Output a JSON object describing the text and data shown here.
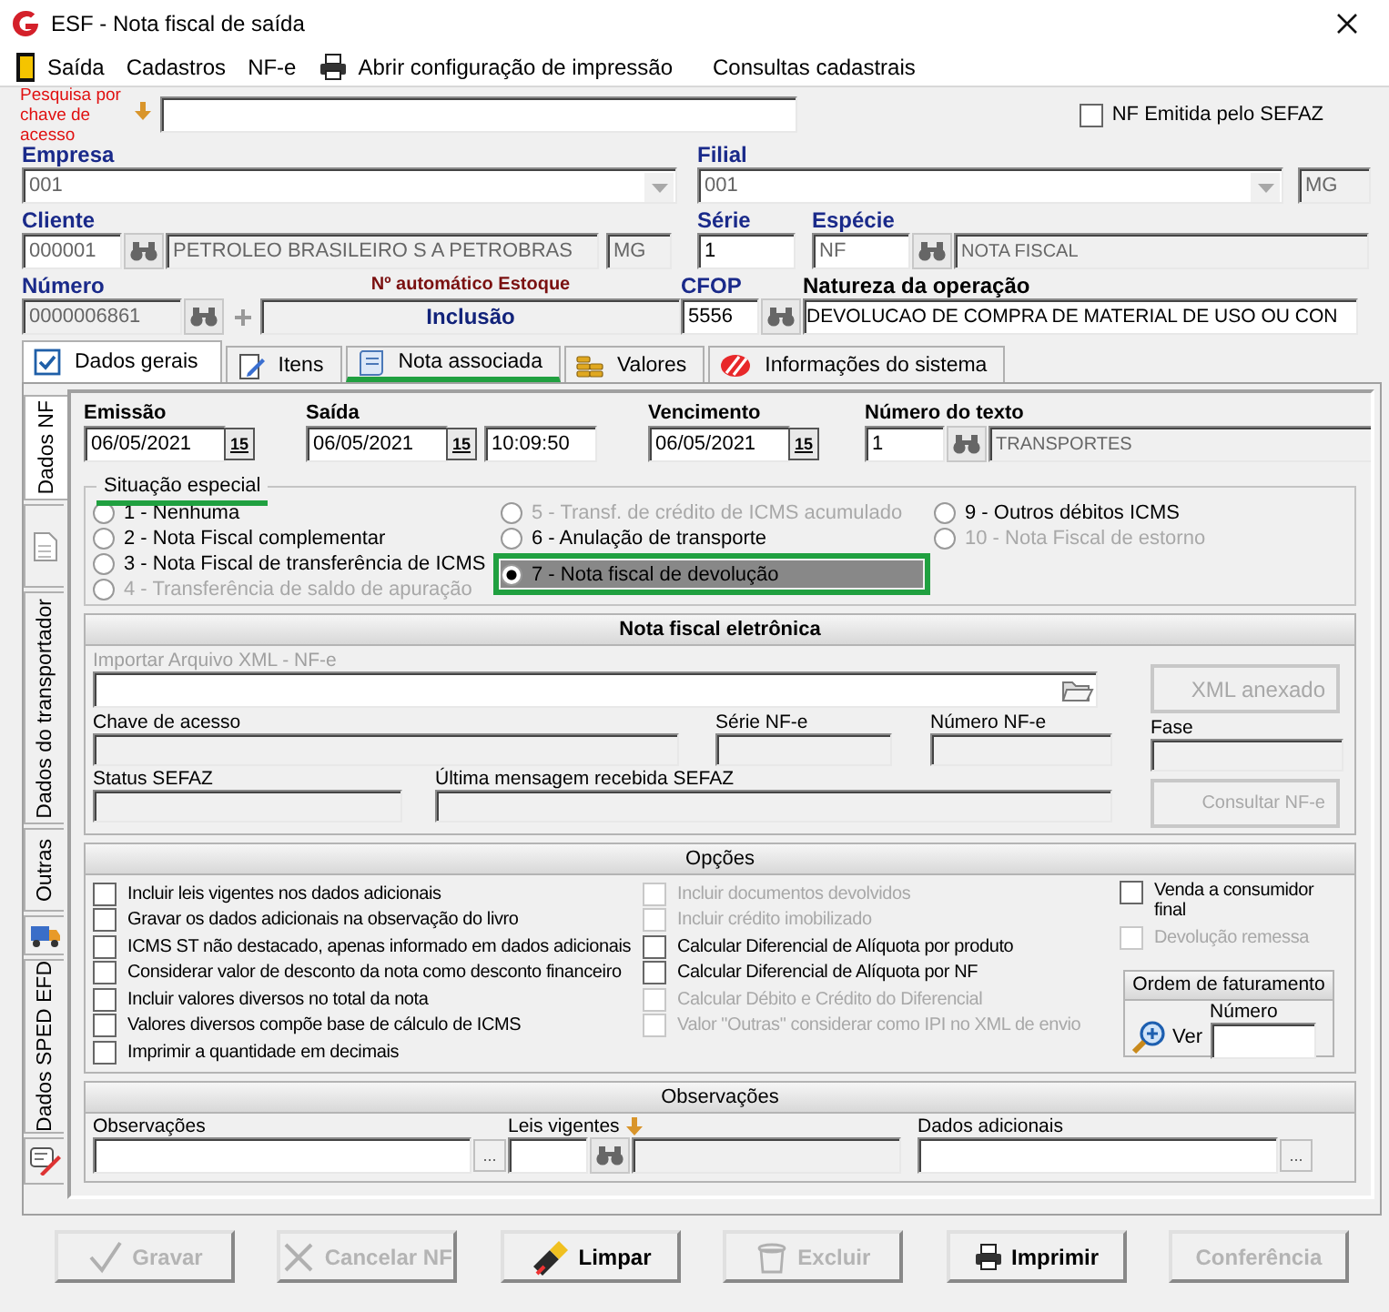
{
  "window": {
    "title": "ESF - Nota fiscal de saída"
  },
  "menu": [
    {
      "label": "Saída"
    },
    {
      "label": "Cadastros"
    },
    {
      "label": "NF-e"
    },
    {
      "label": "Abrir configuração de impressão"
    },
    {
      "label": "Consultas cadastrais"
    }
  ],
  "search": {
    "label": "Pesquisa por chave de acesso"
  },
  "nf_sefaz": {
    "label": "NF Emitida pelo SEFAZ",
    "checked": false
  },
  "empresa": {
    "label": "Empresa",
    "value": "001"
  },
  "filial": {
    "label": "Filial",
    "value": "001",
    "uf": "MG"
  },
  "cliente": {
    "label": "Cliente",
    "code": "000001",
    "name": "PETROLEO BRASILEIRO S A PETROBRAS",
    "uf": "MG"
  },
  "serie": {
    "label": "Série",
    "value": "1"
  },
  "especie": {
    "label": "Espécie",
    "code": "NF",
    "name": "NOTA FISCAL"
  },
  "numero": {
    "label": "Número",
    "value": "0000006861"
  },
  "estoque": {
    "label": "Nº automático Estoque",
    "status": "Inclusão"
  },
  "cfop": {
    "label": "CFOP",
    "value": "5556"
  },
  "natureza": {
    "label": "Natureza da operação",
    "value": "DEVOLUCAO DE COMPRA DE MATERIAL DE USO OU CON"
  },
  "tabs": [
    {
      "label": "Dados gerais",
      "selected": true,
      "highlighted": false
    },
    {
      "label": "Itens",
      "selected": false,
      "highlighted": false
    },
    {
      "label": "Nota associada",
      "selected": false,
      "highlighted": true
    },
    {
      "label": "Valores",
      "selected": false,
      "highlighted": false
    },
    {
      "label": "Informações do sistema",
      "selected": false,
      "highlighted": false
    }
  ],
  "side_tabs": [
    {
      "label": "Dados NF",
      "selected": true
    },
    {
      "selected": false
    },
    {
      "label": "Dados do transportador",
      "selected": false
    },
    {
      "label": "Outras",
      "selected": false
    },
    {
      "selected": false
    },
    {
      "label": "Dados SPED EFD",
      "selected": false
    },
    {
      "selected": false
    }
  ],
  "dates": {
    "emissao": {
      "label": "Emissão",
      "value": "06/05/2021",
      "button": "15"
    },
    "saida": {
      "label": "Saída",
      "value": "06/05/2021",
      "button": "15",
      "time": "10:09:50"
    },
    "vencimento": {
      "label": "Vencimento",
      "value": "06/05/2021",
      "button": "15"
    },
    "numero_texto": {
      "label": "Número do texto",
      "code": "1",
      "name": "TRANSPORTES"
    }
  },
  "situacao": {
    "title": "Situação especial",
    "title_highlighted": true,
    "columns": [
      [
        {
          "label": "1 - Nenhuma",
          "selected": false,
          "disabled": false,
          "highlighted": false
        },
        {
          "label": "2 - Nota Fiscal complementar",
          "selected": false,
          "disabled": false,
          "highlighted": false
        },
        {
          "label": "3 - Nota Fiscal de transferência de ICMS",
          "selected": false,
          "disabled": false,
          "highlighted": false
        },
        {
          "label": "4 - Transferência de saldo de apuração",
          "selected": false,
          "disabled": true,
          "highlighted": false
        }
      ],
      [
        {
          "label": "5 - Transf. de crédito de ICMS acumulado",
          "selected": false,
          "disabled": true,
          "highlighted": false
        },
        {
          "label": "6 - Anulação de transporte",
          "selected": false,
          "disabled": false,
          "highlighted": false
        },
        {
          "label": "7 - Nota fiscal de devolução",
          "selected": true,
          "disabled": false,
          "highlighted": true
        }
      ],
      [
        {
          "label": "9 - Outros débitos ICMS",
          "selected": false,
          "disabled": false,
          "highlighted": false
        },
        {
          "label": "10 - Nota Fiscal de estorno",
          "selected": false,
          "disabled": true,
          "highlighted": false
        }
      ]
    ]
  },
  "nfe": {
    "title": "Nota fiscal eletrônica",
    "import_label": "Importar Arquivo XML - NF-e",
    "xml_button": "XML anexado",
    "chave_label": "Chave de acesso",
    "serie_label": "Série NF-e",
    "numero_label": "Número NF-e",
    "fase_label": "Fase",
    "status_label": "Status SEFAZ",
    "mensagem_label": "Última mensagem recebida SEFAZ",
    "consult_button": "Consultar NF-e"
  },
  "opcoes": {
    "title": "Opções",
    "columns": [
      [
        {
          "label": "Incluir leis vigentes nos dados adicionais",
          "checked": false,
          "disabled": false
        },
        {
          "label": "Gravar os dados adicionais na observação do livro",
          "checked": false,
          "disabled": false
        },
        {
          "label": "ICMS ST  não destacado, apenas informado em dados adicionais",
          "checked": false,
          "disabled": false
        },
        {
          "label": "Considerar valor de desconto da nota como desconto financeiro",
          "checked": false,
          "disabled": false
        },
        {
          "label": "Incluir valores diversos no total da nota",
          "checked": false,
          "disabled": false
        },
        {
          "label": "Valores diversos compõe base de cálculo de ICMS",
          "checked": false,
          "disabled": false
        },
        {
          "label": "Imprimir a quantidade em decimais",
          "checked": false,
          "disabled": false
        }
      ],
      [
        {
          "label": "Incluir documentos devolvidos",
          "checked": false,
          "disabled": true
        },
        {
          "label": "Incluir crédito imobilizado",
          "checked": false,
          "disabled": true
        },
        {
          "label": "Calcular Diferencial de Alíquota por produto",
          "checked": false,
          "disabled": false
        },
        {
          "label": "Calcular Diferencial de Alíquota por NF",
          "checked": false,
          "disabled": false
        },
        {
          "label": "Calcular Débito e Crédito do Diferencial",
          "checked": false,
          "disabled": true
        },
        {
          "label": "Valor \"Outras\" considerar como IPI no XML de envio",
          "checked": false,
          "disabled": true
        }
      ],
      [
        {
          "label": "Venda a consumidor final",
          "checked": false,
          "disabled": false
        },
        {
          "label": "Devolução remessa",
          "checked": false,
          "disabled": true
        }
      ]
    ],
    "ordem": {
      "title": "Ordem de faturamento",
      "ver": "Ver",
      "numero_label": "Número"
    }
  },
  "observacoes": {
    "title": "Observações",
    "obs_label": "Observações",
    "obs_button": "...",
    "leis_label": "Leis vigentes",
    "dados_label": "Dados adicionais",
    "dados_button": "..."
  },
  "buttons": [
    {
      "label": "Gravar",
      "disabled": true
    },
    {
      "label": "Cancelar NF",
      "disabled": true
    },
    {
      "label": "Limpar",
      "disabled": false
    },
    {
      "label": "Excluir",
      "disabled": true
    },
    {
      "label": "Imprimir",
      "disabled": false
    },
    {
      "label": "Conferência",
      "disabled": true
    }
  ]
}
